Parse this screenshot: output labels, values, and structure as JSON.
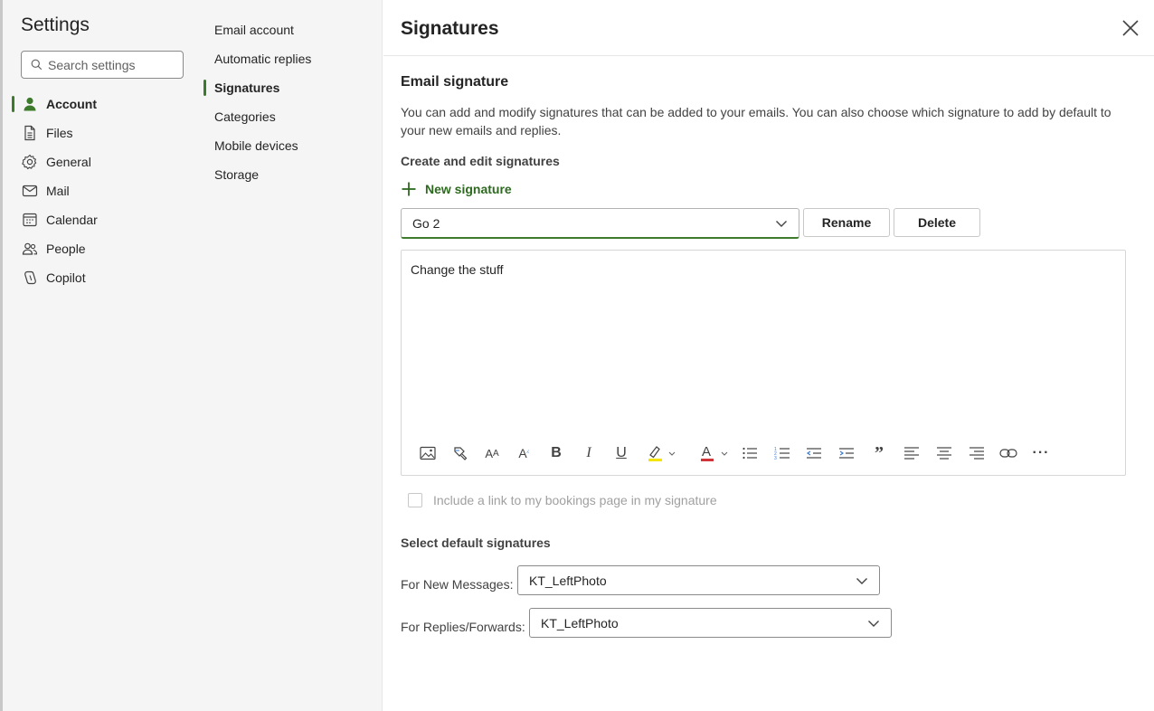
{
  "sidebar": {
    "title": "Settings",
    "search_placeholder": "Search settings",
    "items": [
      {
        "label": "Account",
        "icon": "person-icon"
      },
      {
        "label": "Files",
        "icon": "document-icon"
      },
      {
        "label": "General",
        "icon": "gear-icon"
      },
      {
        "label": "Mail",
        "icon": "mail-icon"
      },
      {
        "label": "Calendar",
        "icon": "calendar-icon"
      },
      {
        "label": "People",
        "icon": "people-icon"
      },
      {
        "label": "Copilot",
        "icon": "copilot-icon"
      }
    ],
    "active": "Account"
  },
  "subnav": {
    "items": [
      "Email account",
      "Automatic replies",
      "Signatures",
      "Categories",
      "Mobile devices",
      "Storage"
    ],
    "active": "Signatures"
  },
  "main": {
    "title": "Signatures",
    "section_title": "Email signature",
    "description": "You can add and modify signatures that can be added to your emails. You can also choose which signature to add by default to your new emails and replies.",
    "create_heading": "Create and edit signatures",
    "new_signature_label": "New signature",
    "selected_signature": "Go 2",
    "rename_label": "Rename",
    "delete_label": "Delete",
    "editor_text": "Change the stuff",
    "toolbar_icons": [
      "image-icon",
      "format-painter-icon",
      "font-size-icon",
      "superscript-icon",
      "bold-icon",
      "italic-icon",
      "underline-icon",
      "highlight-icon",
      "font-color-icon",
      "bullet-list-icon",
      "numbered-list-icon",
      "decrease-indent-icon",
      "increase-indent-icon",
      "quote-icon",
      "align-left-icon",
      "align-center-icon",
      "align-right-icon",
      "link-icon",
      "more-icon"
    ],
    "bookings_label": "Include a link to my bookings page in my signature",
    "default_heading": "Select default signatures",
    "new_messages_label": "For New Messages:",
    "new_messages_value": "KT_LeftPhoto",
    "replies_label": "For Replies/Forwards:",
    "replies_value": "KT_LeftPhoto"
  },
  "colors": {
    "accent": "#3d7a2b",
    "highlight": "#f5e400",
    "font_color": "#d13438"
  }
}
